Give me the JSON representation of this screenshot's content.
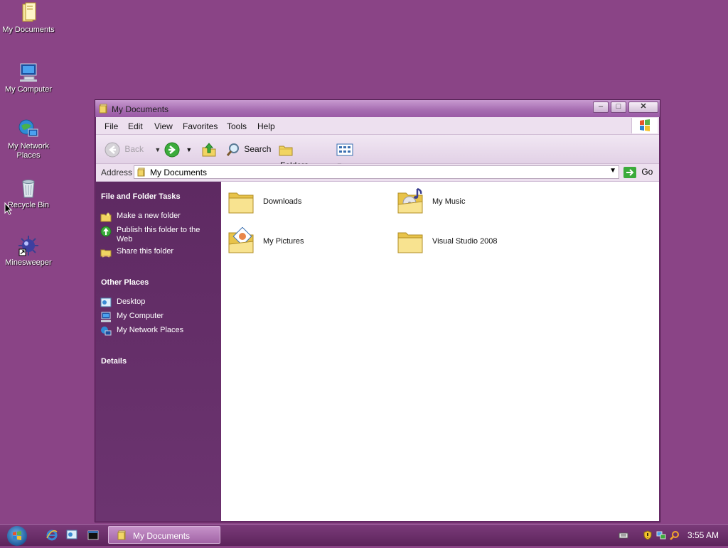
{
  "desktop": {
    "icons": [
      {
        "label": "My Documents",
        "icon": "folder-documents-icon"
      },
      {
        "label": "My Computer",
        "icon": "computer-icon"
      },
      {
        "label": "My Network Places",
        "icon": "network-places-icon"
      },
      {
        "label": "Recycle Bin",
        "icon": "recycle-bin-icon"
      },
      {
        "label": "Minesweeper",
        "icon": "minesweeper-icon"
      }
    ]
  },
  "window": {
    "title": "My Documents",
    "menu": [
      "File",
      "Edit",
      "View",
      "Favorites",
      "Tools",
      "Help"
    ],
    "toolbar": {
      "back": "Back",
      "search": "Search",
      "folders": "Folders"
    },
    "address": {
      "label": "Address",
      "value": "My Documents",
      "go": "Go"
    },
    "tasks": {
      "file_folder_title": "File and Folder Tasks",
      "file_folder_items": [
        "Make a new folder",
        "Publish this folder to the Web",
        "Share this folder"
      ],
      "other_places_title": "Other Places",
      "other_places_items": [
        "Desktop",
        "My Computer",
        "My Network Places"
      ],
      "details_title": "Details"
    },
    "items": [
      {
        "label": "Downloads",
        "icon": "folder-icon"
      },
      {
        "label": "My Music",
        "icon": "music-folder-icon"
      },
      {
        "label": "My Pictures",
        "icon": "pictures-folder-icon"
      },
      {
        "label": "Visual Studio 2008",
        "icon": "folder-icon"
      }
    ]
  },
  "taskbar": {
    "active_window": "My Documents",
    "clock": "3:55 AM"
  },
  "colors": {
    "desktop": "#8a4486",
    "task_pane": "#5e2a62",
    "title_bar": "#a56bb0"
  }
}
